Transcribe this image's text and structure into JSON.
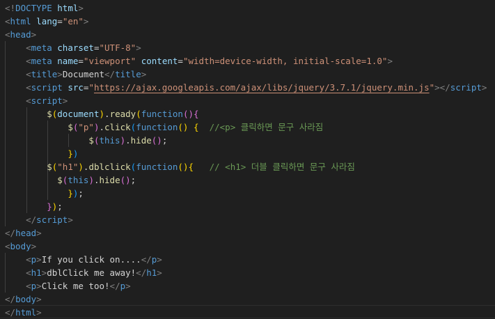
{
  "editor": {
    "language": "html",
    "lines": [
      [
        [
          "<!",
          "p"
        ],
        [
          "DOCTYPE",
          "t"
        ],
        [
          " ",
          "x"
        ],
        [
          "html",
          "a"
        ],
        [
          ">",
          "p"
        ]
      ],
      [
        [
          "<",
          "p"
        ],
        [
          "html",
          "t"
        ],
        [
          " ",
          "x"
        ],
        [
          "lang",
          "a"
        ],
        [
          "=",
          "w"
        ],
        [
          "\"en\"",
          "s"
        ],
        [
          ">",
          "p"
        ]
      ],
      [
        [
          "<",
          "p"
        ],
        [
          "head",
          "t"
        ],
        [
          ">",
          "p"
        ]
      ],
      [
        [
          "    ",
          "x"
        ],
        [
          "<",
          "p"
        ],
        [
          "meta",
          "t"
        ],
        [
          " ",
          "x"
        ],
        [
          "charset",
          "a"
        ],
        [
          "=",
          "w"
        ],
        [
          "\"UTF-8\"",
          "s"
        ],
        [
          ">",
          "p"
        ]
      ],
      [
        [
          "    ",
          "x"
        ],
        [
          "<",
          "p"
        ],
        [
          "meta",
          "t"
        ],
        [
          " ",
          "x"
        ],
        [
          "name",
          "a"
        ],
        [
          "=",
          "w"
        ],
        [
          "\"viewport\"",
          "s"
        ],
        [
          " ",
          "x"
        ],
        [
          "content",
          "a"
        ],
        [
          "=",
          "w"
        ],
        [
          "\"width=device-width, initial-scale=1.0\"",
          "s"
        ],
        [
          ">",
          "p"
        ]
      ],
      [
        [
          "    ",
          "x"
        ],
        [
          "<",
          "p"
        ],
        [
          "title",
          "t"
        ],
        [
          ">",
          "p"
        ],
        [
          "Document",
          "x"
        ],
        [
          "</",
          "p"
        ],
        [
          "title",
          "t"
        ],
        [
          ">",
          "p"
        ]
      ],
      [
        [
          "    ",
          "x"
        ],
        [
          "<",
          "p"
        ],
        [
          "script",
          "t"
        ],
        [
          " ",
          "x"
        ],
        [
          "src",
          "a"
        ],
        [
          "=",
          "w"
        ],
        [
          "\"",
          "s"
        ],
        [
          "https://ajax.googleapis.com/ajax/libs/jquery/3.7.1/jquery.min.js",
          "u"
        ],
        [
          "\"",
          "s"
        ],
        [
          "></",
          "p"
        ],
        [
          "script",
          "t"
        ],
        [
          ">",
          "p"
        ]
      ],
      [
        [
          "    ",
          "x"
        ],
        [
          "<",
          "p"
        ],
        [
          "script",
          "t"
        ],
        [
          ">",
          "p"
        ]
      ],
      [
        [
          "        ",
          "x"
        ],
        [
          "$",
          "f"
        ],
        [
          "(",
          "y"
        ],
        [
          "document",
          "v"
        ],
        [
          ")",
          "y"
        ],
        [
          ".",
          "w"
        ],
        [
          "ready",
          "f"
        ],
        [
          "(",
          "y"
        ],
        [
          "function",
          "k"
        ],
        [
          "()",
          "m"
        ],
        [
          "{",
          "m"
        ]
      ],
      [
        [
          "            ",
          "x"
        ],
        [
          "$",
          "f"
        ],
        [
          "(",
          "m"
        ],
        [
          "\"p\"",
          "s"
        ],
        [
          ")",
          "m"
        ],
        [
          ".",
          "w"
        ],
        [
          "click",
          "f"
        ],
        [
          "(",
          "b"
        ],
        [
          "function",
          "k"
        ],
        [
          "()",
          "y"
        ],
        [
          " ",
          "x"
        ],
        [
          "{",
          "y"
        ],
        [
          "  ",
          "x"
        ],
        [
          "//<p> 클릭하면 문구 사라짐",
          "c"
        ]
      ],
      [
        [
          "                ",
          "x"
        ],
        [
          "$",
          "f"
        ],
        [
          "(",
          "m"
        ],
        [
          "this",
          "k"
        ],
        [
          ")",
          "m"
        ],
        [
          ".",
          "w"
        ],
        [
          "hide",
          "f"
        ],
        [
          "()",
          "m"
        ],
        [
          ";",
          "w"
        ]
      ],
      [
        [
          "            ",
          "x"
        ],
        [
          "}",
          "y"
        ],
        [
          ")",
          "b"
        ]
      ],
      [
        [
          "        ",
          "x"
        ],
        [
          "$",
          "f"
        ],
        [
          "(",
          "y"
        ],
        [
          "\"h1\"",
          "s"
        ],
        [
          ")",
          "y"
        ],
        [
          ".",
          "w"
        ],
        [
          "dblclick",
          "f"
        ],
        [
          "(",
          "b"
        ],
        [
          "function",
          "k"
        ],
        [
          "()",
          "y"
        ],
        [
          "{",
          "y"
        ],
        [
          "   ",
          "x"
        ],
        [
          "// <h1> 더블 클릭하면 문구 사라짐",
          "c"
        ]
      ],
      [
        [
          "          ",
          "x"
        ],
        [
          "$",
          "f"
        ],
        [
          "(",
          "m"
        ],
        [
          "this",
          "k"
        ],
        [
          ")",
          "m"
        ],
        [
          ".",
          "w"
        ],
        [
          "hide",
          "f"
        ],
        [
          "()",
          "m"
        ],
        [
          ";",
          "w"
        ]
      ],
      [
        [
          "            ",
          "x"
        ],
        [
          "}",
          "y"
        ],
        [
          ")",
          "b"
        ],
        [
          ";",
          "w"
        ]
      ],
      [
        [
          "        ",
          "x"
        ],
        [
          "}",
          "m"
        ],
        [
          ")",
          "y"
        ],
        [
          ";",
          "w"
        ]
      ],
      [
        [
          "    ",
          "x"
        ],
        [
          "</",
          "p"
        ],
        [
          "script",
          "t"
        ],
        [
          ">",
          "p"
        ]
      ],
      [
        [
          "</",
          "p"
        ],
        [
          "head",
          "t"
        ],
        [
          ">",
          "p"
        ]
      ],
      [
        [
          "<",
          "p"
        ],
        [
          "body",
          "t"
        ],
        [
          ">",
          "p"
        ]
      ],
      [
        [
          "    ",
          "x"
        ],
        [
          "<",
          "p"
        ],
        [
          "p",
          "t"
        ],
        [
          ">",
          "p"
        ],
        [
          "If you click on....",
          "x"
        ],
        [
          "</",
          "p"
        ],
        [
          "p",
          "t"
        ],
        [
          ">",
          "p"
        ]
      ],
      [
        [
          "    ",
          "x"
        ],
        [
          "<",
          "p"
        ],
        [
          "h1",
          "t"
        ],
        [
          ">",
          "p"
        ],
        [
          "dblClick me away!",
          "x"
        ],
        [
          "</",
          "p"
        ],
        [
          "h1",
          "t"
        ],
        [
          ">",
          "p"
        ]
      ],
      [
        [
          "    ",
          "x"
        ],
        [
          "<",
          "p"
        ],
        [
          "p",
          "t"
        ],
        [
          ">",
          "p"
        ],
        [
          "Click me too!",
          "x"
        ],
        [
          "</",
          "p"
        ],
        [
          "p",
          "t"
        ],
        [
          ">",
          "p"
        ]
      ],
      [
        [
          "</",
          "p"
        ],
        [
          "body",
          "t"
        ],
        [
          ">",
          "p"
        ]
      ],
      [
        [
          "</",
          "p"
        ],
        [
          "html",
          "t"
        ],
        [
          ">",
          "p"
        ]
      ]
    ],
    "current_line": 23
  }
}
